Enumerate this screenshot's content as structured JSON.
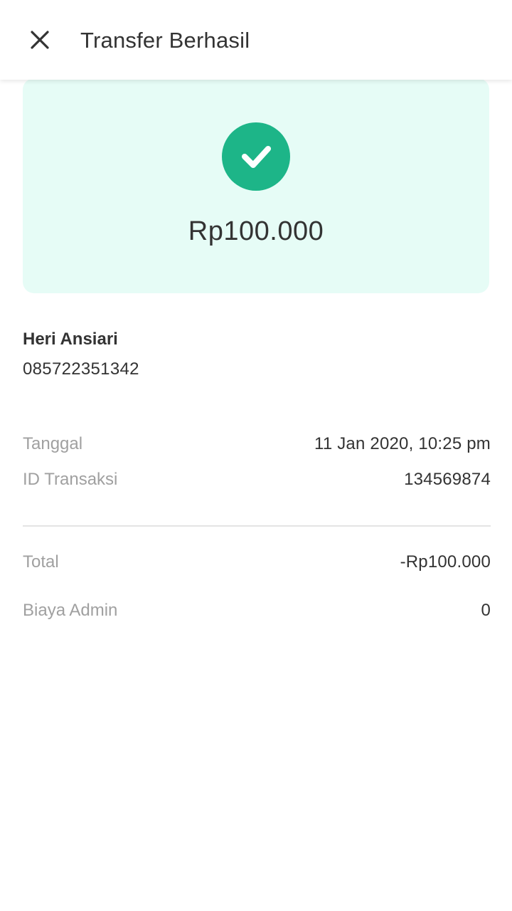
{
  "header": {
    "title": "Transfer Berhasil",
    "close_icon": "close-icon"
  },
  "status": {
    "icon": "check-circle-icon",
    "amount": "Rp100.000",
    "accent_color": "#1db588",
    "card_bg": "#e6fcf6"
  },
  "recipient": {
    "name": "Heri Ansiari",
    "phone": "085722351342"
  },
  "details": {
    "date_label": "Tanggal",
    "date_value": "11 Jan 2020, 10:25 pm",
    "txid_label": "ID Transaksi",
    "txid_value": "134569874"
  },
  "summary": {
    "total_label": "Total",
    "total_value": "-Rp100.000",
    "admin_label": "Biaya Admin",
    "admin_value": "0"
  }
}
